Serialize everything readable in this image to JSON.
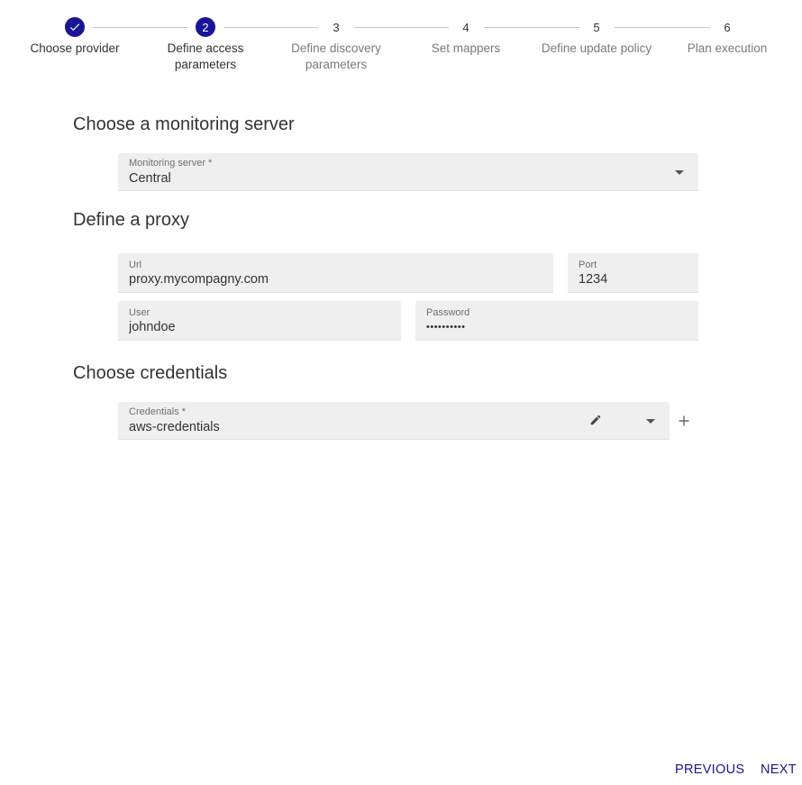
{
  "stepper": {
    "steps": [
      {
        "number": "",
        "label": "Choose provider",
        "state": "done"
      },
      {
        "number": "2",
        "label": "Define access parameters",
        "state": "active"
      },
      {
        "number": "3",
        "label": "Define discovery parameters",
        "state": "pending"
      },
      {
        "number": "4",
        "label": "Set mappers",
        "state": "pending"
      },
      {
        "number": "5",
        "label": "Define update policy",
        "state": "pending"
      },
      {
        "number": "6",
        "label": "Plan execution",
        "state": "pending"
      }
    ],
    "labels": {
      "s1": "Choose provider",
      "s2": "Define access\nparameters",
      "s3": "Define discovery\nparameters",
      "s4": "Set mappers",
      "s5": "Define update policy",
      "s6": "Plan execution"
    },
    "numbers": {
      "s2": "2",
      "s3": "3",
      "s4": "4",
      "s5": "5",
      "s6": "6"
    },
    "accent_color": "#1a1596"
  },
  "monitoring": {
    "title": "Choose a monitoring server",
    "server_label": "Monitoring server *",
    "server_value": "Central"
  },
  "proxy": {
    "title": "Define a proxy",
    "url_label": "Url",
    "url_value": "proxy.mycompagny.com",
    "port_label": "Port",
    "port_value": "1234",
    "user_label": "User",
    "user_value": "johndoe",
    "password_label": "Password",
    "password_value": "••••••••••"
  },
  "credentials": {
    "title": "Choose credentials",
    "label": "Credentials *",
    "value": "aws-credentials",
    "icons": [
      "pencil-icon",
      "chevron-down-icon",
      "plus-icon"
    ]
  },
  "footer": {
    "previous_label": "PREVIOUS",
    "next_label": "NEXT"
  }
}
